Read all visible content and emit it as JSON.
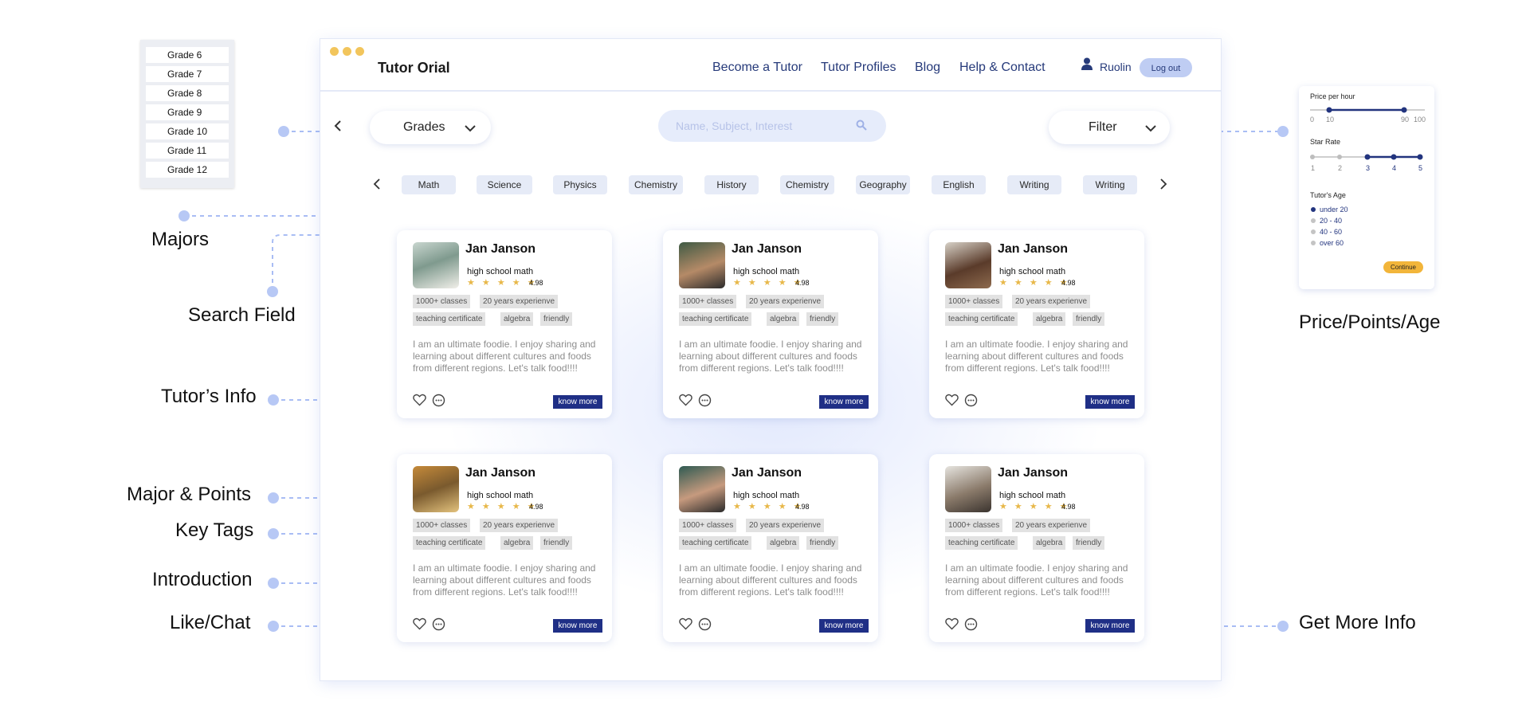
{
  "app": {
    "brand": "Tutor Orial",
    "nav": [
      "Become a Tutor",
      "Tutor Profiles",
      "Blog",
      "Help & Contact"
    ],
    "user_name": "Ruolin",
    "logout_label": "Log out"
  },
  "toolbar": {
    "prev_icon": "chevron-left-icon",
    "grades_label": "Grades",
    "search_placeholder": "Name, Subject, Interest",
    "filter_label": "Filter"
  },
  "subjects": [
    "Math",
    "Science",
    "Physics",
    "Chemistry",
    "History",
    "Chemistry",
    "Geography",
    "English",
    "Writing",
    "Writing"
  ],
  "grades_dropdown": [
    "Grade 6",
    "Grade 7",
    "Grade 8",
    "Grade 9",
    "Grade 10",
    "Grade 11",
    "Grade 12"
  ],
  "cards": [
    {
      "name": "Jan Janson",
      "major": "high school math",
      "stars": "★ ★ ★ ★ ★",
      "rating": "4.98",
      "tags": [
        "1000+ classes",
        "20 years experienve",
        "teaching certificate",
        "algebra",
        "friendly"
      ],
      "intro": "I am an ultimate foodie. I enjoy sharing and learning about different cultures and foods from different regions. Let's talk food!!!!",
      "action": "know more"
    },
    {
      "name": "Jan Janson",
      "major": "high school math",
      "stars": "★ ★ ★ ★ ★",
      "rating": "4.98",
      "tags": [
        "1000+ classes",
        "20 years experienve",
        "teaching certificate",
        "algebra",
        "friendly"
      ],
      "intro": "I am an ultimate foodie. I enjoy sharing and learning about different cultures and foods from different regions. Let's talk food!!!!",
      "action": "know more"
    },
    {
      "name": "Jan Janson",
      "major": "high school math",
      "stars": "★ ★ ★ ★ ★",
      "rating": "4.98",
      "tags": [
        "1000+ classes",
        "20 years experienve",
        "teaching certificate",
        "algebra",
        "friendly"
      ],
      "intro": "I am an ultimate foodie. I enjoy sharing and learning about different cultures and foods from different regions. Let's talk food!!!!",
      "action": "know more"
    },
    {
      "name": "Jan Janson",
      "major": "high school math",
      "stars": "★ ★ ★ ★ ★",
      "rating": "4.98",
      "tags": [
        "1000+ classes",
        "20 years experienve",
        "teaching certificate",
        "algebra",
        "friendly"
      ],
      "intro": "I am an ultimate foodie. I enjoy sharing and learning about different cultures and foods from different regions. Let's talk food!!!!",
      "action": "know more"
    },
    {
      "name": "Jan Janson",
      "major": "high school math",
      "stars": "★ ★ ★ ★ ★",
      "rating": "4.98",
      "tags": [
        "1000+ classes",
        "20 years experienve",
        "teaching certificate",
        "algebra",
        "friendly"
      ],
      "intro": "I am an ultimate foodie. I enjoy sharing and learning about different cultures and foods from different regions. Let's talk food!!!!",
      "action": "know more"
    },
    {
      "name": "Jan Janson",
      "major": "high school math",
      "stars": "★ ★ ★ ★ ★",
      "rating": "4.98",
      "tags": [
        "1000+ classes",
        "20 years experienve",
        "teaching certificate",
        "algebra",
        "friendly"
      ],
      "intro": "I am an ultimate foodie. I enjoy sharing and learning about different cultures and foods from different regions. Let's talk food!!!!",
      "action": "know more"
    }
  ],
  "filter_panel": {
    "price_label": "Price per hour",
    "price_ticks": [
      "0",
      "10",
      "90",
      "100"
    ],
    "price_range": [
      10,
      90
    ],
    "star_label": "Star Rate",
    "star_ticks": [
      "1",
      "2",
      "3",
      "4",
      "5"
    ],
    "star_range": [
      3,
      5
    ],
    "age_label": "Tutor's Age",
    "age_options": [
      "under 20",
      "20 - 40",
      "40 - 60",
      "over 60"
    ],
    "age_selected": "under 20",
    "continue_label": "Continue"
  },
  "annotations": {
    "majors": "Majors",
    "search_field": "Search Field",
    "tutors_info": "Tutor’s Info",
    "major_points": "Major & Points",
    "key_tags": "Key Tags",
    "introduction": "Introduction",
    "like_chat": "Like/Chat",
    "price_points_age": "Price/Points/Age",
    "get_more_info": "Get More Info"
  },
  "colors": {
    "accent": "#1f2f86",
    "nav_text": "#263a7a",
    "window_dots": "#f2c55c",
    "star": "#e8b84a",
    "continue_button": "#f2b53a",
    "connector": "#a9bdf4",
    "chip_bg": "#e6ebf7"
  }
}
